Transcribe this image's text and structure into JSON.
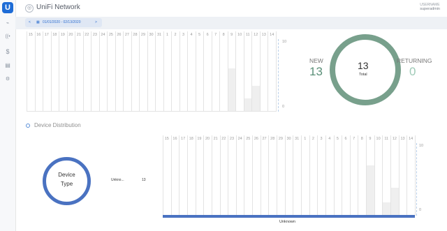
{
  "app": {
    "logo_letter": "U",
    "brand": "UniFi Network"
  },
  "user": {
    "label": "USERNAME",
    "name": "superadmin"
  },
  "date_range": {
    "prev": "<",
    "value": "01/01/2020 - 02/13/2020",
    "next": ">"
  },
  "sidebar": [
    {
      "icon": "dashboard-pulse-icon",
      "glyph": "⌁"
    },
    {
      "icon": "wifi-icon",
      "glyph": "((•"
    },
    {
      "icon": "dollar-icon",
      "glyph": "$"
    },
    {
      "icon": "table-icon",
      "glyph": "▤"
    },
    {
      "icon": "settings-icon",
      "glyph": "⚙"
    }
  ],
  "clients": {
    "new_label": "NEW",
    "new_value": "13",
    "total_value": "13",
    "total_label": "Total",
    "returning_label": "RETURNING",
    "returning_value": "0"
  },
  "chart1": {
    "days": [
      "15",
      "16",
      "17",
      "18",
      "19",
      "20",
      "21",
      "22",
      "23",
      "24",
      "25",
      "26",
      "27",
      "28",
      "29",
      "30",
      "31",
      "1",
      "2",
      "3",
      "4",
      "5",
      "6",
      "7",
      "8",
      "9",
      "10",
      "11",
      "12",
      "13",
      "14"
    ],
    "y_top": "10",
    "y_bottom": "0",
    "bars": [
      {
        "day_index": 25,
        "value": 6
      },
      {
        "day_index": 27,
        "value": 1.8
      },
      {
        "day_index": 28,
        "value": 3.5
      }
    ],
    "ymax": 10
  },
  "device_distribution": {
    "title": "Device Distribution",
    "ring_label_line1": "Device",
    "ring_label_line2": "Type",
    "legend_label": "Unkno...",
    "legend_value": "13"
  },
  "chart2": {
    "days": [
      "15",
      "16",
      "17",
      "18",
      "19",
      "20",
      "21",
      "22",
      "23",
      "24",
      "25",
      "26",
      "27",
      "28",
      "29",
      "30",
      "31",
      "1",
      "2",
      "3",
      "4",
      "5",
      "6",
      "7",
      "8",
      "9",
      "10",
      "11",
      "12",
      "13",
      "14"
    ],
    "y_top": "10",
    "y_bottom": "0",
    "bars": [
      {
        "day_index": 25,
        "value": 7
      },
      {
        "day_index": 27,
        "value": 1.8
      },
      {
        "day_index": 28,
        "value": 3.8
      }
    ],
    "ymax": 10,
    "footer_label": "Unknown",
    "footer_color": "#4a72c1"
  },
  "colors": {
    "accent": "#1e6cd6",
    "ring": "#78a08c",
    "new": "#5a8f78",
    "returning": "#9fcab7",
    "device": "#4a72c1"
  }
}
